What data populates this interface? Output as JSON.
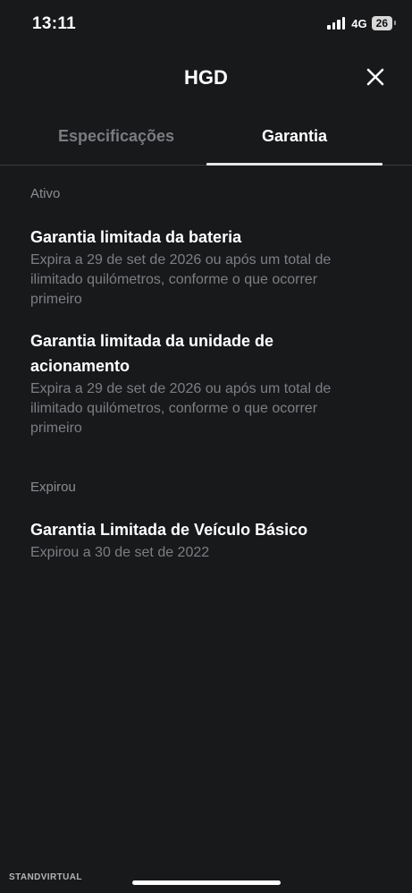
{
  "status_bar": {
    "time": "13:11",
    "network": "4G",
    "battery": "26"
  },
  "header": {
    "title": "HGD"
  },
  "tabs": [
    {
      "label": "Especificações",
      "active": false
    },
    {
      "label": "Garantia",
      "active": true
    }
  ],
  "sections": {
    "active": {
      "label": "Ativo",
      "items": [
        {
          "title": "Garantia limitada da bateria",
          "description": "Expira a 29 de set de 2026 ou após um total de ilimitado quilómetros, conforme o que ocorrer primeiro"
        },
        {
          "title": "Garantia limitada da unidade de acionamento",
          "description": "Expira a 29 de set de 2026 ou após um total de ilimitado quilómetros, conforme o que ocorrer primeiro"
        }
      ]
    },
    "expired": {
      "label": "Expirou",
      "items": [
        {
          "title": "Garantia Limitada de Veículo Básico",
          "description": "Expirou a 30 de set de 2022"
        }
      ]
    }
  },
  "watermark": "STANDVIRTUAL",
  "icons": {
    "close": "close-icon",
    "signal": "signal-icon",
    "battery": "battery-icon"
  },
  "colors": {
    "background": "#18191b",
    "text_primary": "#ffffff",
    "text_secondary": "#7d7e82",
    "tab_inactive": "#7b7c80"
  }
}
